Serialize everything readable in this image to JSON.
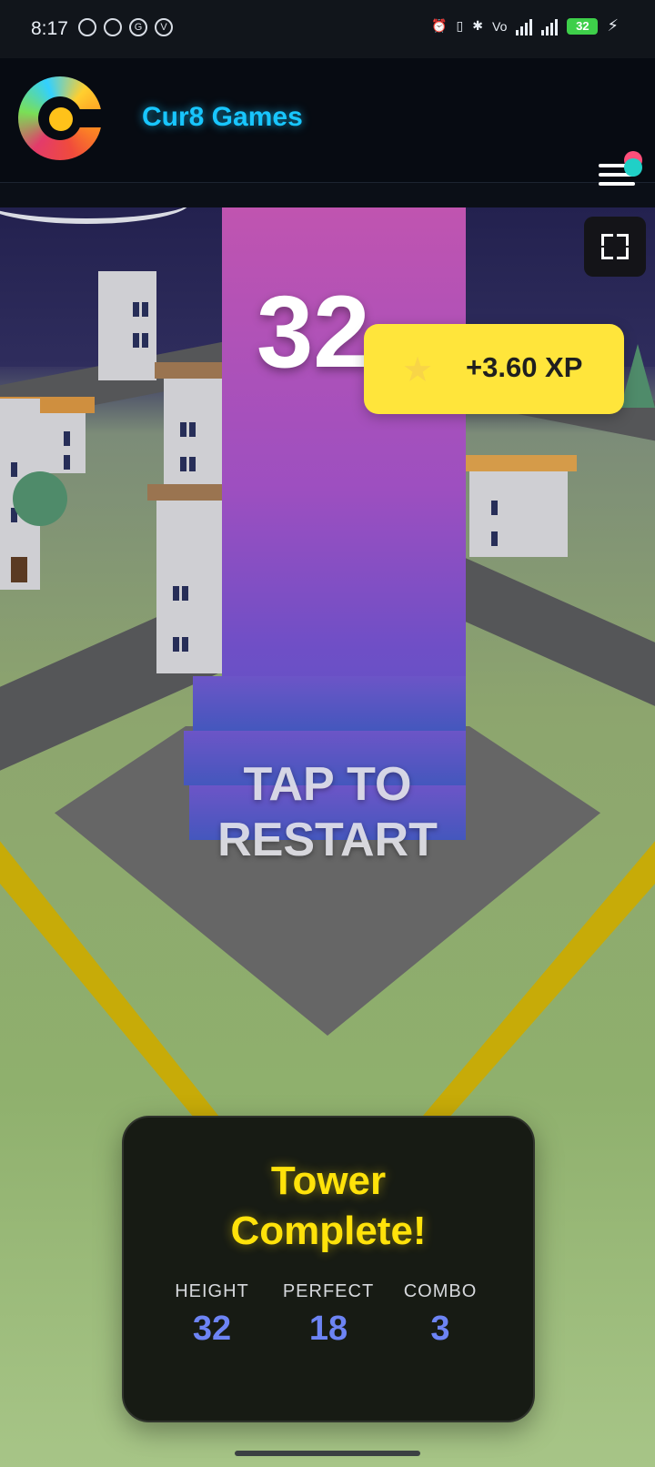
{
  "status_bar": {
    "time": "8:17",
    "battery": "32"
  },
  "header": {
    "brand": "Cur8 Games"
  },
  "game": {
    "score": "32",
    "xp_gain": "+3.60 XP",
    "restart_line_1": "TAP TO",
    "restart_line_2": "RESTART"
  },
  "result": {
    "title_line_1": "Tower",
    "title_line_2": "Complete!",
    "stats": [
      {
        "label": "HEIGHT",
        "value": "32"
      },
      {
        "label": "PERFECT",
        "value": "18"
      },
      {
        "label": "COMBO",
        "value": "3"
      }
    ]
  },
  "colors": {
    "brand": "#18c6ff",
    "xp_badge": "#ffe53b",
    "result_title": "#ffe20a",
    "stat_value": "#6d84f4"
  }
}
